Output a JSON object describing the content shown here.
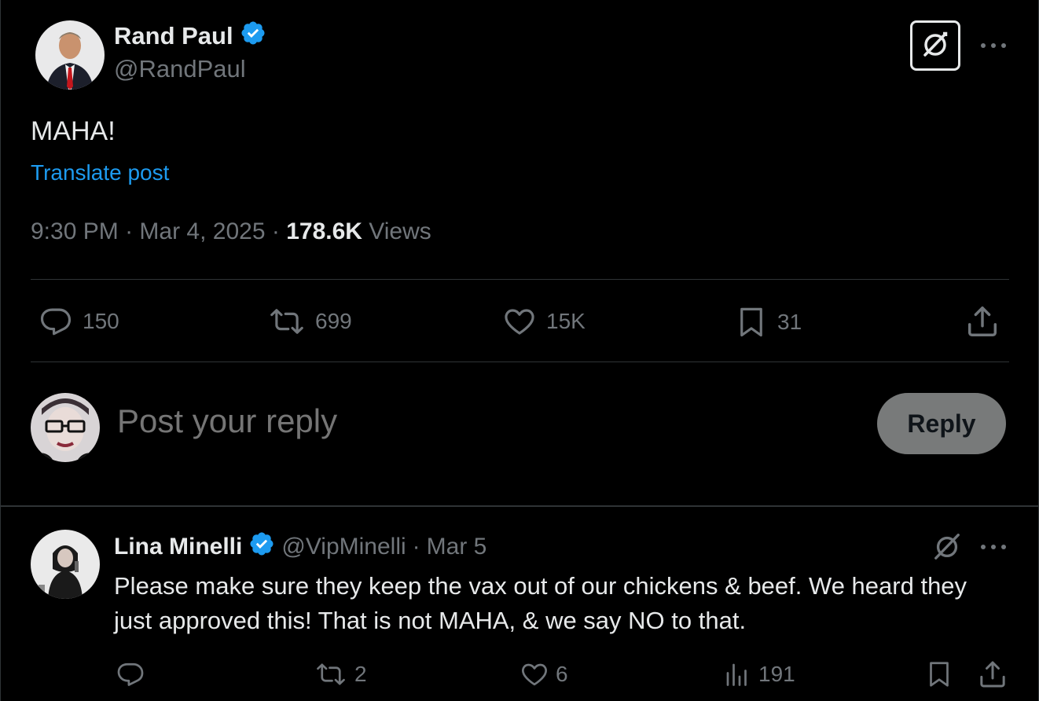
{
  "post": {
    "author_name": "Rand Paul",
    "author_handle": "@RandPaul",
    "text": "MAHA!",
    "translate_label": "Translate post",
    "time": "9:30 PM",
    "date": "Mar 4, 2025",
    "views_count": "178.6K",
    "views_label": "Views",
    "separator": "·"
  },
  "actions": {
    "replies": "150",
    "reposts": "699",
    "likes": "15K",
    "bookmarks": "31"
  },
  "composer": {
    "placeholder": "Post your reply",
    "reply_button": "Reply"
  },
  "reply": {
    "author_name": "Lina Minelli",
    "author_handle": "@VipMinelli",
    "date": "Mar 5",
    "separator": "·",
    "text": "Please make sure they keep the vax out of our chickens & beef. We heard they just approved this! That is not MAHA, & we say NO to that.",
    "actions": {
      "replies": "",
      "reposts": "2",
      "likes": "6",
      "views": "191"
    }
  },
  "colors": {
    "background": "#000000",
    "text": "#e7e9ea",
    "secondary": "#71767b",
    "link": "#1d9bf0",
    "verified": "#1d9bf0",
    "divider": "#2f3336",
    "reply_button_bg": "#787a7a"
  },
  "icons": {
    "verified": "verified-badge-icon",
    "grok": "grok-icon",
    "more": "more-icon",
    "reply": "reply-icon",
    "repost": "repost-icon",
    "like": "like-icon",
    "bookmark": "bookmark-icon",
    "share": "share-icon",
    "views": "views-icon"
  }
}
